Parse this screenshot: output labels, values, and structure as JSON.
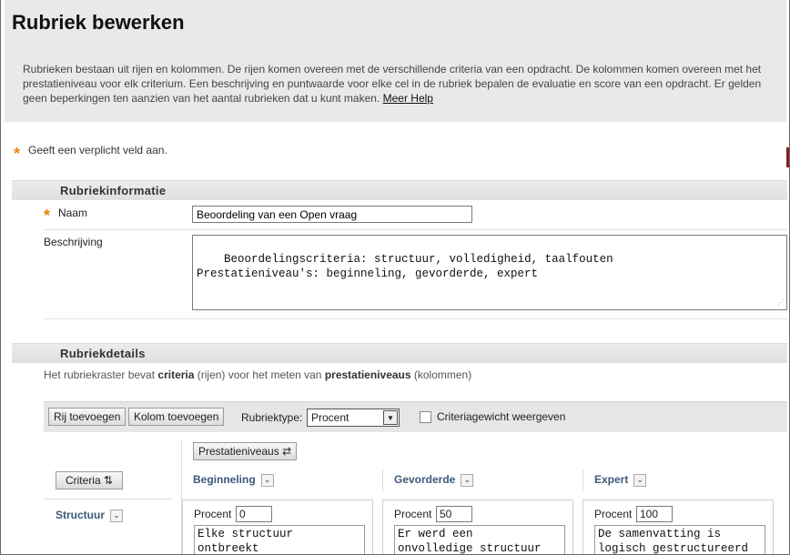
{
  "page": {
    "title": "Rubriek bewerken",
    "intro": "Rubrieken bestaan uit rijen en kolommen. De rijen komen overeen met de verschillende criteria van een opdracht. De kolommen komen overeen met het prestatieniveau voor elk criterium. Een beschrijving en puntwaarde voor elke cel in de rubriek bepalen de evaluatie en score van een opdracht. Er gelden geen beperkingen ten aanzien van het aantal rubrieken dat u kunt maken.",
    "help_link": "Meer Help",
    "required_note": "Geeft een verplicht veld aan."
  },
  "info_section": {
    "heading": "Rubriekinformatie",
    "name_label": "Naam",
    "name_value": "Beoordeling van een Open vraag",
    "description_label": "Beschrijving",
    "description_value": "Beoordelingscriteria: structuur, volledigheid, taalfouten\nPrestatieniveau's: beginneling, gevorderde, expert"
  },
  "details_section": {
    "heading": "Rubriekdetails",
    "note_prefix": "Het rubriekraster bevat ",
    "note_criteria": "criteria",
    "note_middle": " (rijen) voor het meten van ",
    "note_levels": "prestatieniveaus",
    "note_suffix": " (kolommen)"
  },
  "toolbar": {
    "add_row": "Rij toevoegen",
    "add_column": "Kolom toevoegen",
    "type_label": "Rubriektype:",
    "type_value": "Procent",
    "weight_checkbox": "Criteriagewicht weergeven",
    "weight_checked": false
  },
  "grid": {
    "levels_button": "Prestatieniveaus",
    "criteria_button": "Criteria",
    "columns": [
      {
        "label": "Beginneling"
      },
      {
        "label": "Gevorderde"
      },
      {
        "label": "Expert"
      }
    ],
    "rows": [
      {
        "label": "Structuur",
        "cells": [
          {
            "percent_label": "Procent",
            "percent": "0",
            "text": "Elke structuur\nontbreekt"
          },
          {
            "percent_label": "Procent",
            "percent": "50",
            "text": "Er werd een\nonvolledige structuur"
          },
          {
            "percent_label": "Procent",
            "percent": "100",
            "text": "De samenvatting is\nlogisch gestructureerd"
          }
        ]
      }
    ]
  },
  "icons": {
    "required": "asterisk-icon",
    "swap": "swap-arrows-icon",
    "sort": "sort-arrows-icon",
    "menu": "chevron-down-icon"
  },
  "colors": {
    "required_star": "#e8850c",
    "header_bg": "#e9e9e9",
    "column_heading": "#3b5a7a"
  }
}
